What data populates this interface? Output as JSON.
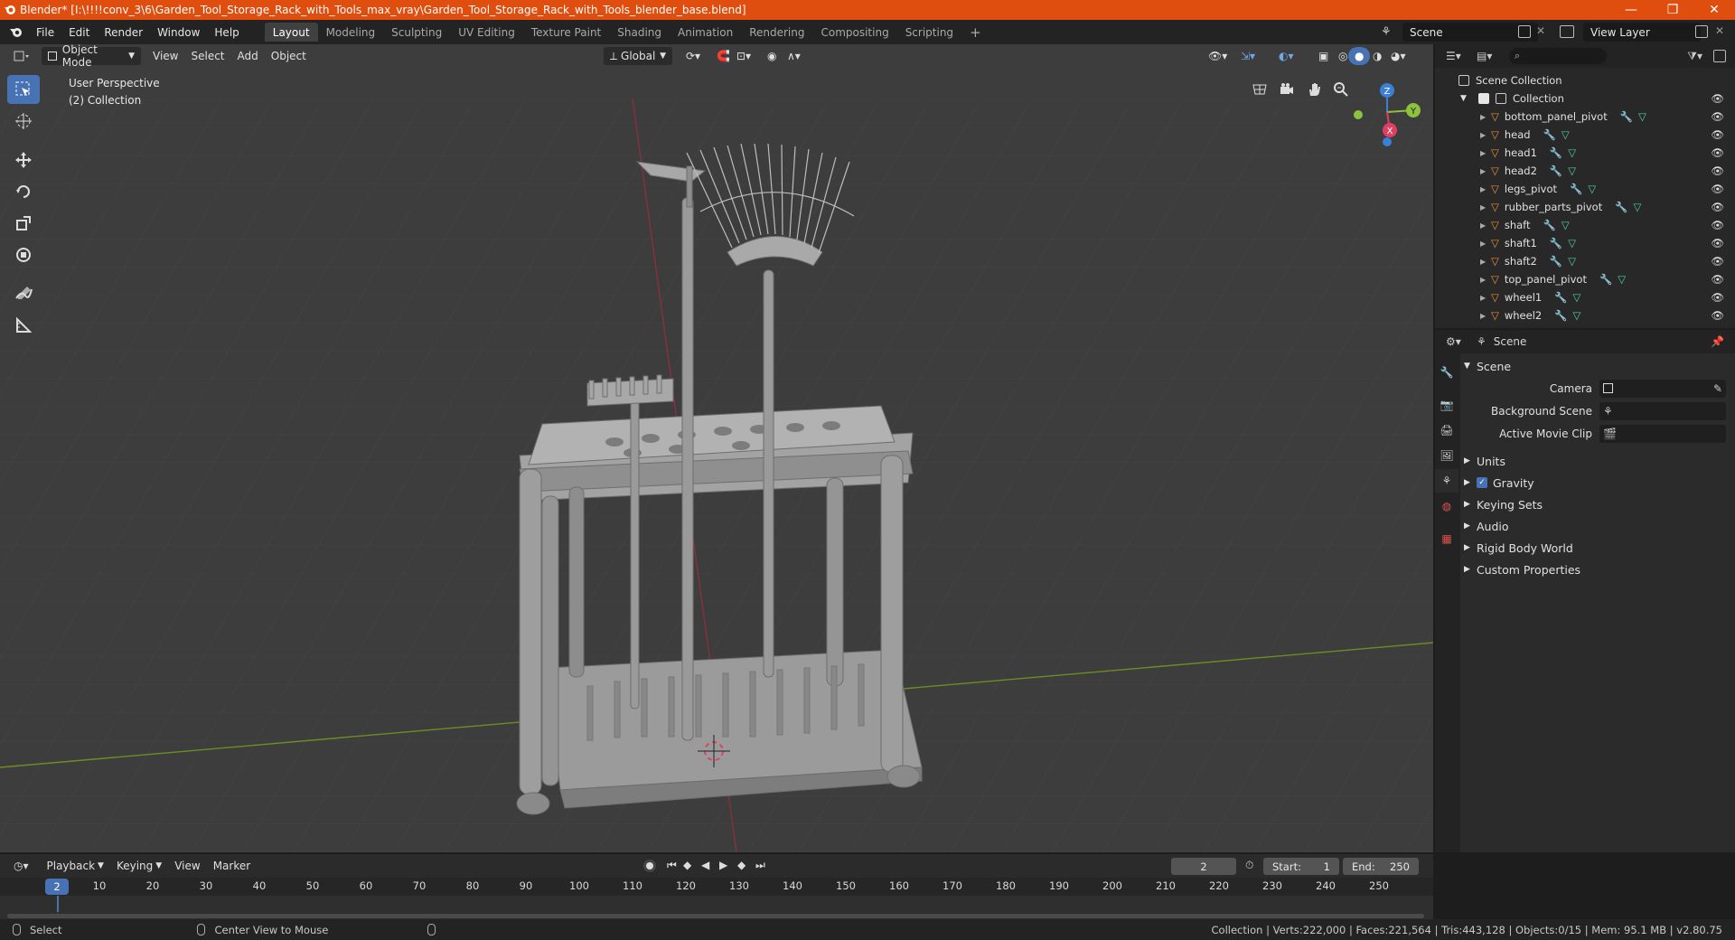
{
  "titlebar": {
    "title": "Blender* [I:\\!!!!conv_3\\6\\Garden_Tool_Storage_Rack_with_Tools_max_vray\\Garden_Tool_Storage_Rack_with_Tools_blender_base.blend]",
    "minimize": "—",
    "maximize": "❐",
    "close": "✕"
  },
  "menu": [
    "File",
    "Edit",
    "Render",
    "Window",
    "Help"
  ],
  "workspaces": [
    "Layout",
    "Modeling",
    "Sculpting",
    "UV Editing",
    "Texture Paint",
    "Shading",
    "Animation",
    "Rendering",
    "Compositing",
    "Scripting"
  ],
  "active_workspace": "Layout",
  "add_workspace": "+",
  "scene_name": "Scene",
  "view_layer_name": "View Layer",
  "viewport": {
    "mode": "Object Mode",
    "menus": [
      "View",
      "Select",
      "Add",
      "Object"
    ],
    "orientation": "Global",
    "overlay_line1": "User Perspective",
    "overlay_line2": "(2) Collection",
    "gizmo_labels": {
      "z": "Z",
      "y": "Y",
      "x": "X"
    }
  },
  "outliner": {
    "root": "Scene Collection",
    "collection": "Collection",
    "items": [
      {
        "name": "bottom_panel_pivot"
      },
      {
        "name": "head"
      },
      {
        "name": "head1"
      },
      {
        "name": "head2"
      },
      {
        "name": "legs_pivot"
      },
      {
        "name": "rubber_parts_pivot"
      },
      {
        "name": "shaft"
      },
      {
        "name": "shaft1"
      },
      {
        "name": "shaft2"
      },
      {
        "name": "top_panel_pivot"
      },
      {
        "name": "wheel1"
      },
      {
        "name": "wheel2"
      }
    ]
  },
  "properties": {
    "header": "Scene",
    "panel": "Scene",
    "rows": [
      {
        "label": "Camera"
      },
      {
        "label": "Background Scene"
      },
      {
        "label": "Active Movie Clip"
      }
    ],
    "subpanels": [
      "Units",
      "Gravity",
      "Keying Sets",
      "Audio",
      "Rigid Body World",
      "Custom Properties"
    ]
  },
  "timeline": {
    "menus": [
      "Playback",
      "Keying",
      "View",
      "Marker"
    ],
    "current_frame": "2",
    "start_label": "Start:",
    "start": "1",
    "end_label": "End:",
    "end": "250",
    "ruler": [
      "10",
      "20",
      "30",
      "40",
      "50",
      "60",
      "70",
      "80",
      "90",
      "100",
      "110",
      "120",
      "130",
      "140",
      "150",
      "160",
      "170",
      "180",
      "190",
      "200",
      "210",
      "220",
      "230",
      "240",
      "250"
    ]
  },
  "statusbar": {
    "left1": "Select",
    "left2": "Center View to Mouse",
    "stats": "Collection | Verts:222,000 | Faces:221,564 | Tris:443,128 | Objects:0/15 | Mem: 95.1 MB | v2.80.75"
  },
  "colors": {
    "accent": "#4772b3",
    "titlebar": "#e04e0f",
    "object_icon": "#e8903a",
    "mesh_icon": "#4fd09b",
    "axis_x": "#e04060",
    "axis_y": "#8dc23f",
    "axis_z": "#3c7fd6"
  }
}
